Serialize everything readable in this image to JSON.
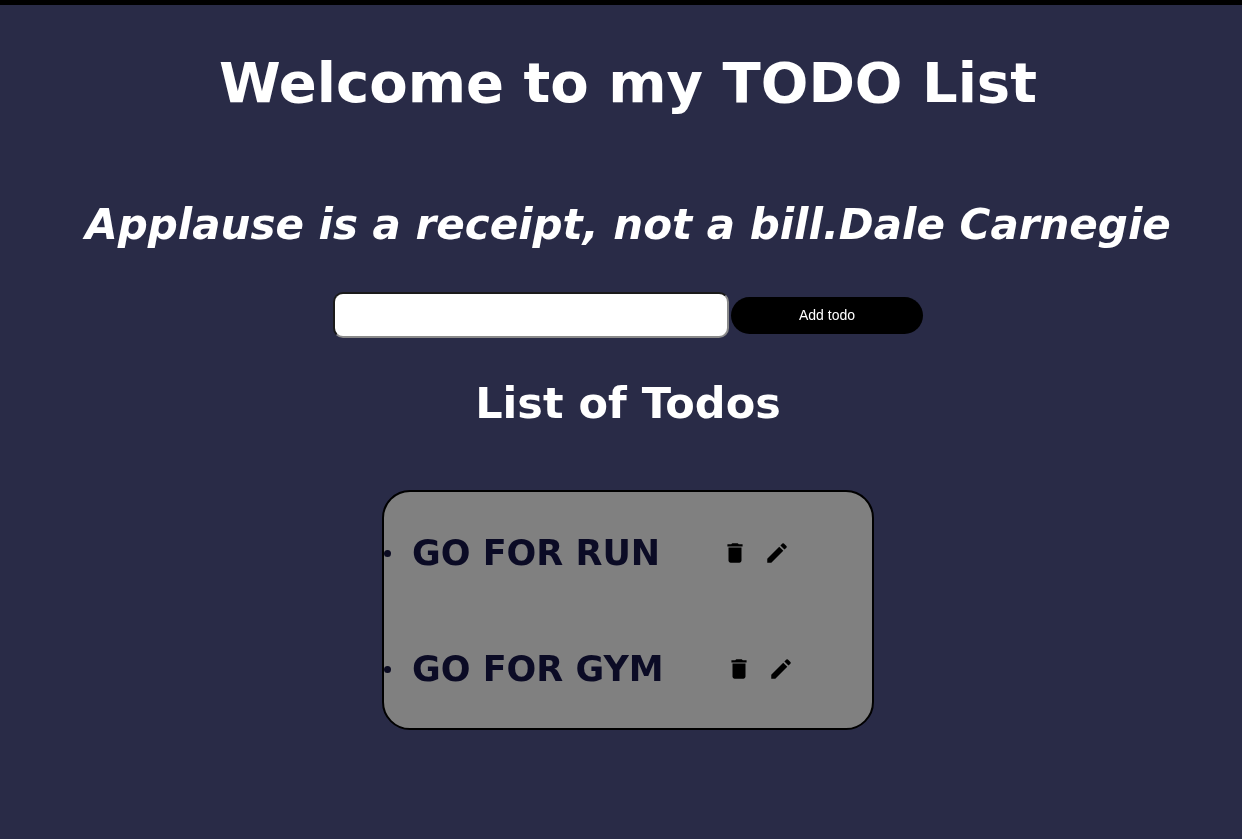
{
  "header": {
    "title": "Welcome to my TODO List",
    "quote": "Applause is a receipt, not a bill.Dale Carnegie"
  },
  "todo_form": {
    "button": "Add todo"
  },
  "todo_list": {
    "title": "List of Todos",
    "items": [
      {
        "text": "GO FOR RUN"
      },
      {
        "text": "GO FOR GYM"
      }
    ]
  }
}
